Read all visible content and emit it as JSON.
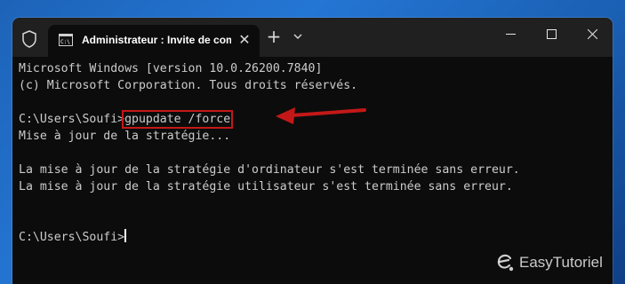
{
  "window": {
    "tab_title": "Administrateur : Invite de commandes",
    "close_tab_glyph": "✕",
    "new_tab_glyph": "+",
    "icons": [
      "shield-icon",
      "cmd-icon",
      "close-icon",
      "plus-icon",
      "chevron-down-icon",
      "minimize-icon",
      "maximize-icon",
      "close-window-icon"
    ]
  },
  "terminal": {
    "line1": "Microsoft Windows [version 10.0.26200.7840]",
    "line2": "(c) Microsoft Corporation. Tous droits réservés.",
    "prompt1": "C:\\Users\\Soufi>",
    "command": "gpupdate /force",
    "line4": "Mise à jour de la stratégie...",
    "line6": "La mise à jour de la stratégie d'ordinateur s'est terminée sans erreur.",
    "line7": "La mise à jour de la stratégie utilisateur s'est terminée sans erreur.",
    "prompt2": "C:\\Users\\Soufi>"
  },
  "colors": {
    "highlight": "#c41818",
    "terminal_bg": "#0c0c0c",
    "text": "#cccccc"
  },
  "watermark": {
    "text": "EasyTutoriel"
  }
}
